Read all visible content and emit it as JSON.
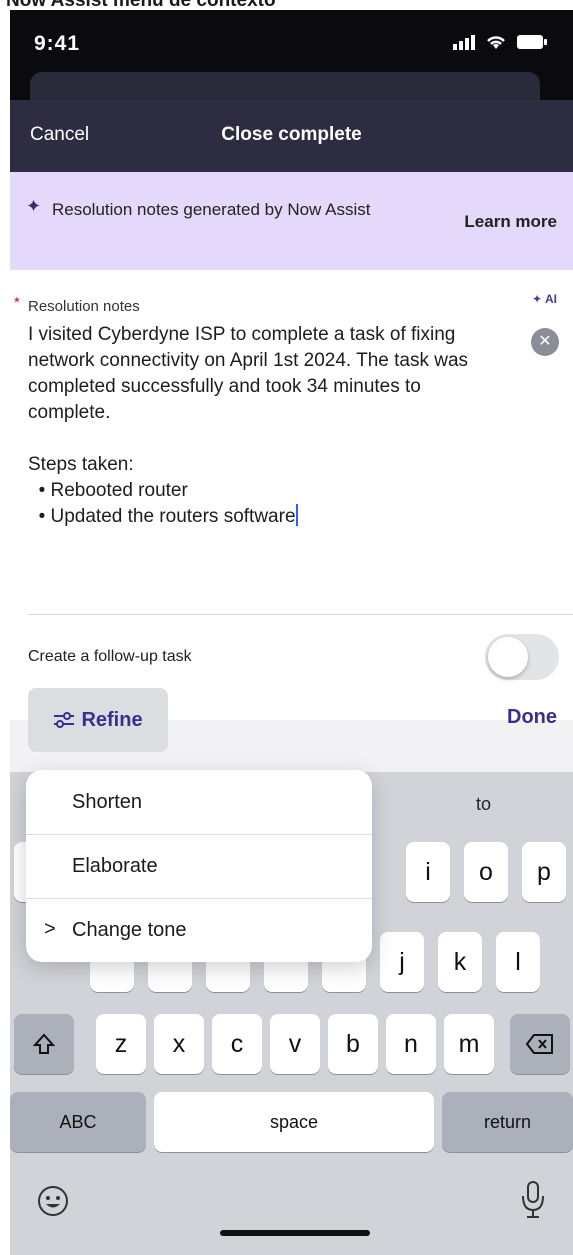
{
  "caption": "Now Assist menu de contexto",
  "status": {
    "time": "9:41"
  },
  "header": {
    "cancel_label": "Cancel",
    "title": "Close complete"
  },
  "banner": {
    "text": "Resolution notes generated by Now Assist",
    "learn_more": "Learn more"
  },
  "form": {
    "resolution_label": "Resolution notes",
    "ai_tag": "AI",
    "notes_text": "I visited Cyberdyne ISP to complete a task of fixing network connectivity on April 1st 2024. The task was completed successfully and took 34 minutes to complete.\n\nSteps taken:\n  • Rebooted router\n  • Updated the routers software",
    "followup_label": "Create a follow-up task",
    "followup_enabled": false
  },
  "toolbar": {
    "refine_label": "Refine",
    "done_label": "Done"
  },
  "refine_menu": {
    "shorten": "Shorten",
    "elaborate": "Elaborate",
    "change_tone": "Change tone"
  },
  "keyboard": {
    "suggestion_right": "to",
    "row1_visible": [
      "i",
      "o",
      "p"
    ],
    "row2_visible": [
      "j",
      "k",
      "l"
    ],
    "row3": [
      "z",
      "x",
      "c",
      "v",
      "b",
      "n",
      "m"
    ],
    "abc_label": "ABC",
    "space_label": "space",
    "return_label": "return"
  },
  "colors": {
    "header": "#2d2c40",
    "banner": "#e4d9fb",
    "accent": "#3a2f8f",
    "required": "#c8102e"
  }
}
